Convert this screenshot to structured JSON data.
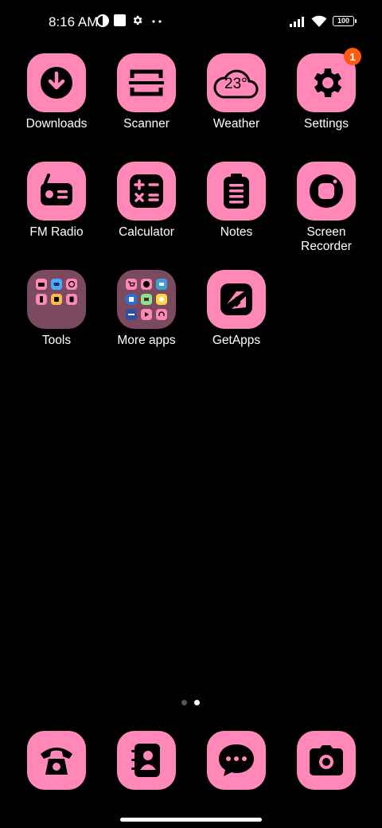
{
  "status_bar": {
    "time": "8:16 AM",
    "battery": "100",
    "icons": [
      "data-saver-icon",
      "notification-square-icon",
      "gear-icon",
      "more-dots-icon",
      "signal-icon",
      "wifi-icon",
      "battery-icon"
    ]
  },
  "apps": [
    {
      "label": "Downloads",
      "icon": "download-icon"
    },
    {
      "label": "Scanner",
      "icon": "scanner-icon"
    },
    {
      "label": "Weather",
      "icon": "cloud-icon",
      "temp": "23°"
    },
    {
      "label": "Settings",
      "icon": "gear-icon",
      "badge": "1"
    },
    {
      "label": "FM Radio",
      "icon": "radio-icon"
    },
    {
      "label": "Calculator",
      "icon": "calculator-icon"
    },
    {
      "label": "Notes",
      "icon": "clipboard-icon"
    },
    {
      "label": "Screen\nRecorder",
      "icon": "record-icon"
    },
    {
      "label": "Tools",
      "icon": "folder-icon"
    },
    {
      "label": "More apps",
      "icon": "folder-icon"
    },
    {
      "label": "GetApps",
      "icon": "getapps-icon"
    }
  ],
  "dock": [
    {
      "name": "phone",
      "icon": "phone-icon"
    },
    {
      "name": "contacts",
      "icon": "contacts-icon"
    },
    {
      "name": "messages",
      "icon": "message-icon"
    },
    {
      "name": "camera",
      "icon": "camera-icon"
    }
  ],
  "page_indicator": {
    "pages": 2,
    "active": 2
  },
  "colors": {
    "icon_bg": "#ff88b8",
    "background": "#000000",
    "badge": "#ff5a12",
    "folder_bg": "#7b4a5f"
  }
}
